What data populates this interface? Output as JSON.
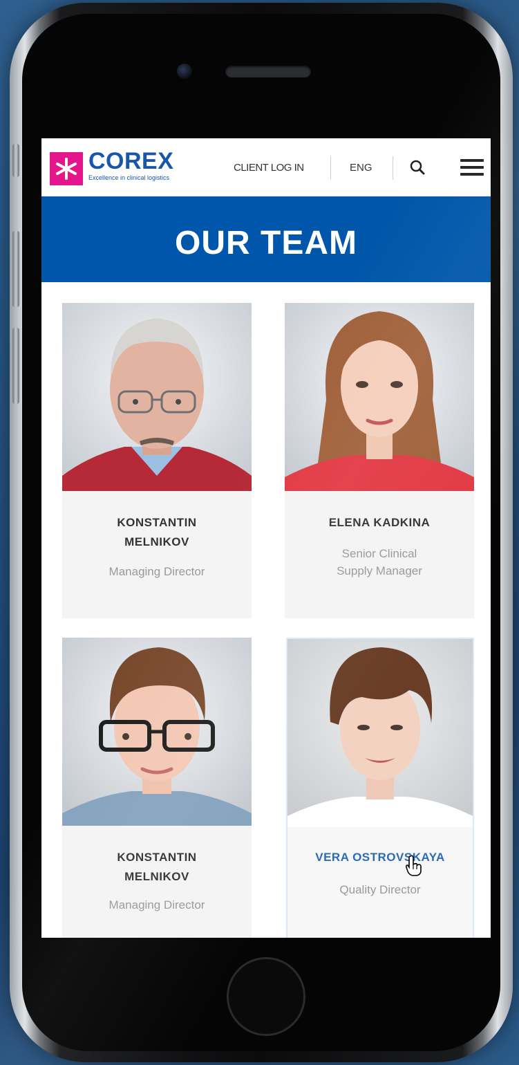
{
  "header": {
    "logo_name": "COREX",
    "logo_tagline": "Excellence in clinical logistics",
    "client_login": "CLIENT LOG IN",
    "language": "ENG"
  },
  "banner": {
    "title": "OUR TEAM"
  },
  "team": [
    {
      "name": "KONSTANTIN MELNIKOV",
      "role": "Managing Director"
    },
    {
      "name": "ELENA KADKINA",
      "role": "Senior Clinical Supply Manager"
    },
    {
      "name": "KONSTANTIN MELNIKOV",
      "role": "Managing Director"
    },
    {
      "name": "VERA OSTROVSKAYA",
      "role": "Quality Director"
    }
  ],
  "colors": {
    "brand_blue": "#0056aa",
    "brand_magenta": "#e5168c",
    "link_blue": "#2a6bb8"
  }
}
